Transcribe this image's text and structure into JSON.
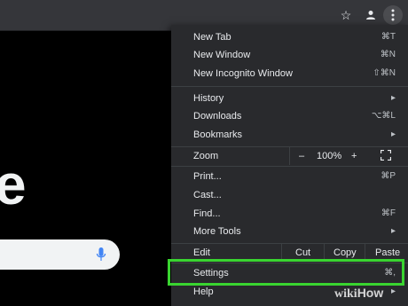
{
  "toolbar": {
    "star_icon": "star-icon",
    "profile_icon": "profile-icon",
    "menu_icon": "vertical-dots-icon"
  },
  "page": {
    "logo_fragment": "e"
  },
  "menu": {
    "items": [
      {
        "label": "New Tab",
        "shortcut": "⌘T"
      },
      {
        "label": "New Window",
        "shortcut": "⌘N"
      },
      {
        "label": "New Incognito Window",
        "shortcut": "⇧⌘N"
      },
      {
        "label": "History",
        "shortcut": "▸"
      },
      {
        "label": "Downloads",
        "shortcut": "⌥⌘L"
      },
      {
        "label": "Bookmarks",
        "shortcut": "▸"
      },
      {
        "label": "Zoom",
        "shortcut": ""
      },
      {
        "label": "Print...",
        "shortcut": "⌘P"
      },
      {
        "label": "Cast...",
        "shortcut": ""
      },
      {
        "label": "Find...",
        "shortcut": "⌘F"
      },
      {
        "label": "More Tools",
        "shortcut": "▸"
      },
      {
        "label": "Edit",
        "shortcut": ""
      },
      {
        "label": "Settings",
        "shortcut": "⌘,"
      },
      {
        "label": "Help",
        "shortcut": "▸"
      }
    ],
    "zoom": {
      "minus": "–",
      "value": "100%",
      "plus": "+"
    },
    "edit": {
      "cut": "Cut",
      "copy": "Copy",
      "paste": "Paste"
    }
  },
  "highlight_color": "#39d430",
  "watermark": {
    "wiki": "wiki",
    "how": "How"
  }
}
